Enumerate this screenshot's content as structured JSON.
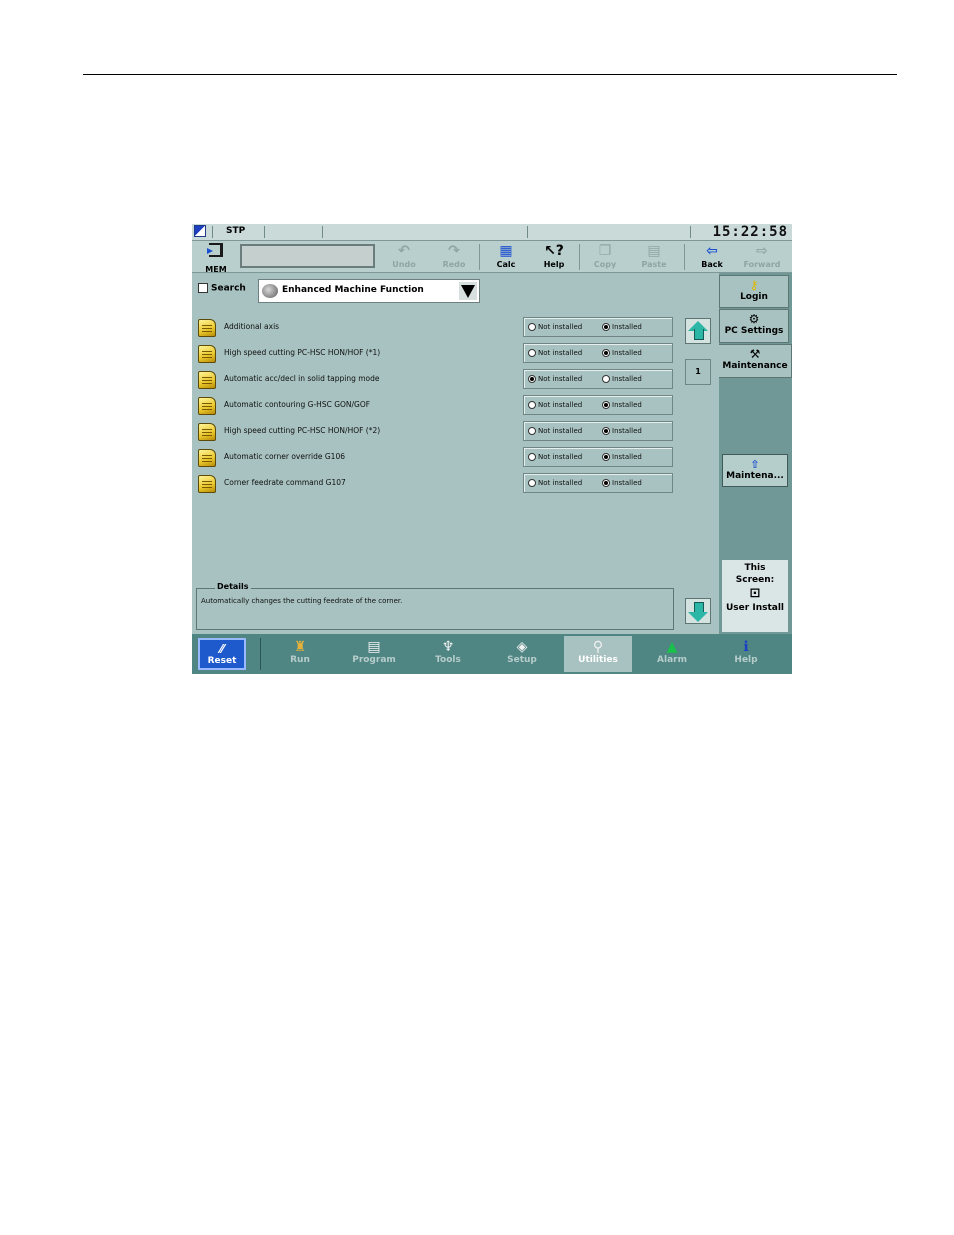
{
  "status": {
    "mode": "STP",
    "clock": "15:22:58"
  },
  "toolbar": {
    "mem_label": "MEM",
    "undo": "Undo",
    "redo": "Redo",
    "calc": "Calc",
    "help": "Help",
    "copy": "Copy",
    "paste": "Paste",
    "back": "Back",
    "forward": "Forward"
  },
  "search": {
    "label": "Search",
    "dropdown_value": "Enhanced Machine Function"
  },
  "rows": [
    {
      "name": "Additional axis",
      "opt1": "Not installed",
      "opt2": "Installed",
      "selected": "Installed"
    },
    {
      "name": "High speed cutting PC-HSC HON/HOF (*1)",
      "opt1": "Not installed",
      "opt2": "Installed",
      "selected": "Installed"
    },
    {
      "name": "Automatic acc/decl in solid tapping mode",
      "opt1": "Not installed",
      "opt2": "Installed",
      "selected": "Not installed"
    },
    {
      "name": "Automatic contouring G-HSC GON/GOF",
      "opt1": "Not installed",
      "opt2": "Installed",
      "selected": "Installed"
    },
    {
      "name": "High speed cutting PC-HSC HON/HOF (*2)",
      "opt1": "Not installed",
      "opt2": "Installed",
      "selected": "Installed"
    },
    {
      "name": "Automatic corner override G106",
      "opt1": "Not installed",
      "opt2": "Installed",
      "selected": "Installed"
    },
    {
      "name": "Corner feedrate command G107",
      "opt1": "Not installed",
      "opt2": "Installed",
      "selected": "Installed"
    }
  ],
  "page_number": "1",
  "details": {
    "legend": "Details",
    "text": "Automatically changes the cutting feedrate of the corner."
  },
  "right_panel": {
    "login": "Login",
    "pc_settings": "PC Settings",
    "maintenance": "Maintenance",
    "maintena_button": "Maintena...",
    "this_screen_1": "This",
    "this_screen_2": "Screen:",
    "user_install": "User Install"
  },
  "bottom_nav": {
    "reset": "Reset",
    "run": "Run",
    "program": "Program",
    "tools": "Tools",
    "setup": "Setup",
    "utilities": "Utilities",
    "alarm": "Alarm",
    "help": "Help"
  },
  "colors": {
    "screen_bg": "#a7c2c0",
    "panel": "#6f9896",
    "nav_bar": "#4f8583",
    "reset": "#1f5acd",
    "arrow": "#2cb6a6"
  },
  "icons": [
    "mem-icon",
    "undo-icon",
    "redo-icon",
    "calc-icon",
    "help-icon",
    "copy-icon",
    "paste-icon",
    "back-icon",
    "forward-icon",
    "key-icon",
    "pc-settings-icon",
    "maintenance-icon",
    "note-icon",
    "up-arrow-icon",
    "down-arrow-icon",
    "run-icon",
    "program-icon",
    "tools-icon",
    "setup-icon",
    "utilities-icon",
    "alarm-icon",
    "info-icon"
  ]
}
